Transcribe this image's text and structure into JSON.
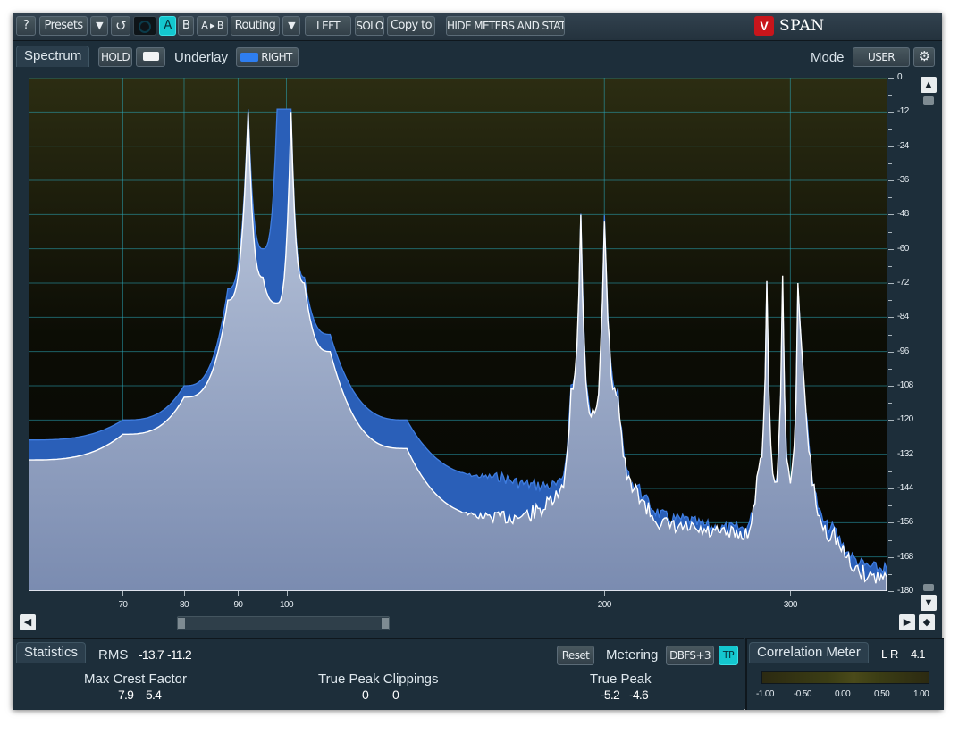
{
  "toolbar": {
    "help": "?",
    "presets": "Presets",
    "dropdown_glyph": "▼",
    "undo_glyph": "↺",
    "a": "A",
    "b": "B",
    "ab": "A ▸ B",
    "routing": "Routing",
    "left": "LEFT",
    "solo": "SOLO",
    "copy_to": "Copy to",
    "hide_meters": "HIDE METERS AND STATS"
  },
  "brand": {
    "logo": "V",
    "name": "SPAN"
  },
  "spectrum": {
    "tab": "Spectrum",
    "hold": "HOLD",
    "underlay_label": "Underlay",
    "underlay_value": "RIGHT",
    "mode_label": "Mode",
    "mode_value": "USER",
    "y_ticks": [
      "0",
      "-12",
      "-24",
      "-36",
      "-48",
      "-60",
      "-72",
      "-84",
      "-96",
      "-108",
      "-120",
      "-132",
      "-144",
      "-156",
      "-168",
      "-180"
    ],
    "x_ticks": [
      "70",
      "80",
      "90",
      "100",
      "200",
      "300"
    ],
    "colors": {
      "plot_bg": "#0a0c08",
      "grid": "#2aa6b8",
      "left_fill": "#a5b1c9",
      "left_line": "#ffffff",
      "right_fill": "#2a5fb8",
      "right_line": "#3f7de0"
    }
  },
  "statistics": {
    "tab": "Statistics",
    "rms_label": "RMS",
    "rms_left": "-13.7",
    "rms_right": "-11.2",
    "reset": "Reset",
    "metering_label": "Metering",
    "metering_value": "DBFS+3",
    "tp": "TP",
    "crest_label": "Max Crest Factor",
    "crest_left": "7.9",
    "crest_right": "5.4",
    "clip_label": "True Peak Clippings",
    "clip_left": "0",
    "clip_right": "0",
    "peak_label": "True Peak",
    "peak_left": "-5.2",
    "peak_right": "-4.6"
  },
  "correlation": {
    "tab": "Correlation Meter",
    "mode": "L-R",
    "value": "4.1",
    "scale": [
      "-1.00",
      "-0.50",
      "0.00",
      "0.50",
      "1.00"
    ]
  },
  "chart_data": {
    "type": "area",
    "title": "",
    "xlabel": "",
    "ylabel": "",
    "x_scale": "log",
    "x_ticks": [
      70,
      80,
      90,
      100,
      200,
      300
    ],
    "y_ticks": [
      0,
      -12,
      -24,
      -36,
      -48,
      -60,
      -72,
      -84,
      -96,
      -108,
      -120,
      -132,
      -144,
      -156,
      -168,
      -180
    ],
    "ylim": [
      -180,
      0
    ],
    "xlim": [
      57,
      370
    ],
    "grid": true,
    "series": [
      {
        "name": "LEFT",
        "x": [
          57,
          70,
          80,
          88,
          92,
          95,
          98,
          101,
          104,
          110,
          130,
          160,
          180,
          186,
          190,
          195,
          200,
          206,
          215,
          240,
          270,
          280,
          285,
          290,
          295,
          300,
          305,
          330,
          370
        ],
        "y": [
          -134,
          -125,
          -112,
          -78,
          -12,
          -70,
          -79,
          -12,
          -72,
          -96,
          -130,
          -154,
          -147,
          -108,
          -48,
          -118,
          -48,
          -110,
          -145,
          -158,
          -160,
          -135,
          -71,
          -140,
          -71,
          -140,
          -71,
          -160,
          -175
        ]
      },
      {
        "name": "RIGHT",
        "x": [
          57,
          70,
          80,
          88,
          92,
          95,
          98,
          101,
          104,
          110,
          130,
          160,
          180,
          186,
          190,
          195,
          200,
          206,
          215,
          240,
          270,
          280,
          285,
          290,
          295,
          300,
          305,
          330,
          370
        ],
        "y": [
          -127,
          -120,
          -108,
          -74,
          -11,
          -60,
          -11,
          -11,
          -70,
          -90,
          -120,
          -140,
          -143,
          -108,
          -48,
          -118,
          -48,
          -110,
          -143,
          -155,
          -158,
          -136,
          -72,
          -141,
          -72,
          -141,
          -72,
          -158,
          -172
        ]
      }
    ]
  }
}
